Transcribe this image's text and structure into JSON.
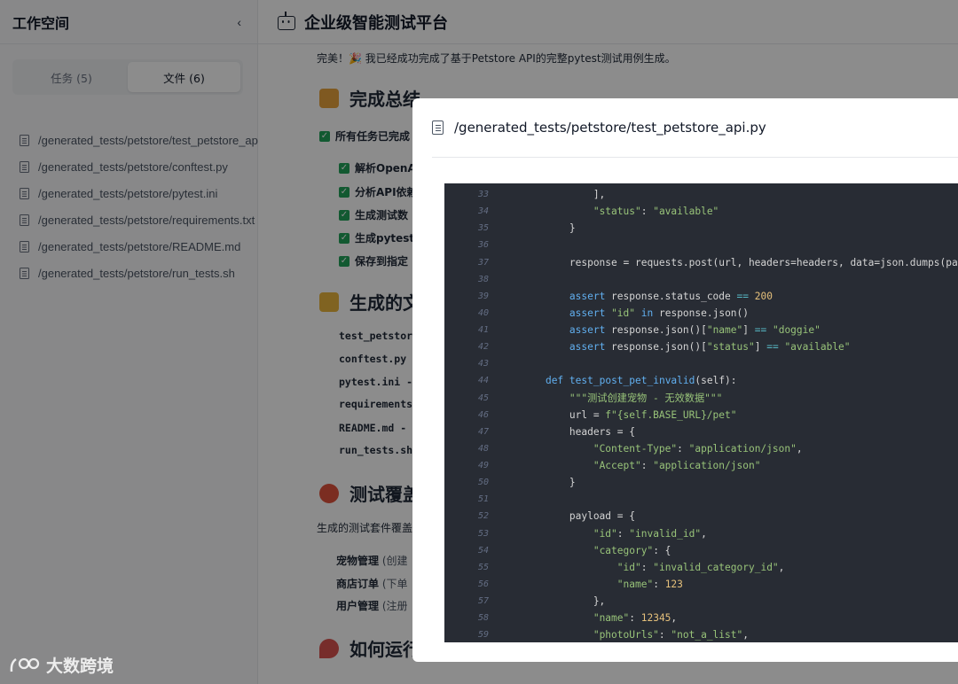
{
  "sidebar": {
    "title": "工作空间",
    "collapse_icon": "chevron-left-icon",
    "tabs": [
      {
        "label": "任务 (5)",
        "active": false
      },
      {
        "label": "文件 (6)",
        "active": true
      }
    ],
    "files": [
      "/generated_tests/petstore/test_petstore_api.py",
      "/generated_tests/petstore/conftest.py",
      "/generated_tests/petstore/pytest.ini",
      "/generated_tests/petstore/requirements.txt",
      "/generated_tests/petstore/README.md",
      "/generated_tests/petstore/run_tests.sh"
    ]
  },
  "main": {
    "title": "企业级智能测试平台",
    "intro": "完美！🎉 我已经成功完成了基于Petstore API的完整pytest测试用例生成。",
    "summary_heading": "完成总结",
    "all_done": "所有任务已完成",
    "checklist": [
      "解析OpenA",
      "分析API依赖",
      "生成测试数",
      "生成pytest",
      "保存到指定"
    ],
    "files_heading": "生成的文",
    "file_rows": [
      "test_petstor",
      "conftest.py",
      "pytest.ini -",
      "requirements",
      "README.md - 说",
      "run_tests.sh"
    ],
    "coverage_heading": "测试覆盖",
    "coverage_para": "生成的测试套件覆盖",
    "coverage_rows": [
      {
        "name": "宠物管理",
        "desc": " (创建"
      },
      {
        "name": "商店订单",
        "desc": " (下单"
      },
      {
        "name": "用户管理",
        "desc": " (注册"
      }
    ],
    "run_heading": "如何运行"
  },
  "modal": {
    "title": "/generated_tests/petstore/test_petstore_api.py",
    "code_lines": [
      {
        "n": "33",
        "t": "            ],"
      },
      {
        "n": "34",
        "t": "            \"status\": \"available\""
      },
      {
        "n": "35",
        "t": "        }"
      },
      {
        "n": "36",
        "t": ""
      },
      {
        "n": "37",
        "t": "        response = requests.post(url, headers=headers, data=json.dumps(payload))"
      },
      {
        "n": "38",
        "t": ""
      },
      {
        "n": "39",
        "t": "        assert response.status_code == 200"
      },
      {
        "n": "40",
        "t": "        assert \"id\" in response.json()"
      },
      {
        "n": "41",
        "t": "        assert response.json()[\"name\"] == \"doggie\""
      },
      {
        "n": "42",
        "t": "        assert response.json()[\"status\"] == \"available\""
      },
      {
        "n": "43",
        "t": ""
      },
      {
        "n": "44",
        "t": "    def test_post_pet_invalid(self):"
      },
      {
        "n": "45",
        "t": "        \"\"\"测试创建宠物 - 无效数据\"\"\""
      },
      {
        "n": "46",
        "t": "        url = f\"{self.BASE_URL}/pet\""
      },
      {
        "n": "47",
        "t": "        headers = {"
      },
      {
        "n": "48",
        "t": "            \"Content-Type\": \"application/json\","
      },
      {
        "n": "49",
        "t": "            \"Accept\": \"application/json\""
      },
      {
        "n": "50",
        "t": "        }"
      },
      {
        "n": "51",
        "t": ""
      },
      {
        "n": "52",
        "t": "        payload = {"
      },
      {
        "n": "53",
        "t": "            \"id\": \"invalid_id\","
      },
      {
        "n": "54",
        "t": "            \"category\": {"
      },
      {
        "n": "55",
        "t": "                \"id\": \"invalid_category_id\","
      },
      {
        "n": "56",
        "t": "                \"name\": 123"
      },
      {
        "n": "57",
        "t": "            },"
      },
      {
        "n": "58",
        "t": "            \"name\": 12345,"
      },
      {
        "n": "59",
        "t": "            \"photoUrls\": \"not_a_list\","
      }
    ]
  },
  "watermark": "大数跨境",
  "colors": {
    "overlay": "#000000",
    "code_bg": "#282c34",
    "keyword": "#61afef",
    "string": "#98c379",
    "number": "#e5c07b",
    "check": "#22a35a"
  }
}
